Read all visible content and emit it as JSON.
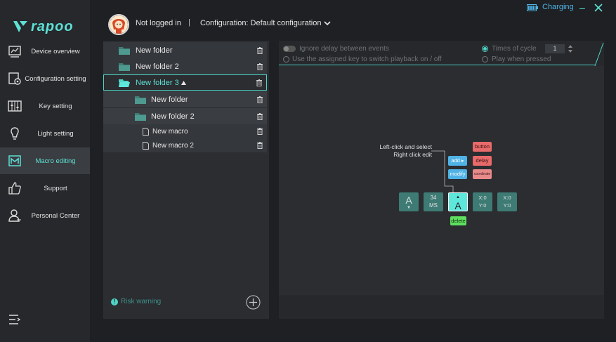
{
  "app": {
    "logo_text": "rapoo"
  },
  "header": {
    "login_status": "Not logged in",
    "separator": "|",
    "configuration": "Configuration: Default configuration",
    "charging": "Charging",
    "minimize": "–"
  },
  "sidebar": {
    "items": [
      {
        "label": "Device overview",
        "icon": "device-overview-icon"
      },
      {
        "label": "Configuration setting",
        "icon": "configuration-icon"
      },
      {
        "label": "Key setting",
        "icon": "key-setting-icon"
      },
      {
        "label": "Light setting",
        "icon": "light-bulb-icon"
      },
      {
        "label": "Macro editing",
        "icon": "macro-icon",
        "active": true
      },
      {
        "label": "Support",
        "icon": "thumbs-up-icon"
      },
      {
        "label": "Personal Center",
        "icon": "person-icon"
      }
    ]
  },
  "tree": {
    "rows": [
      {
        "label": "New folder",
        "type": "folder"
      },
      {
        "label": "New folder 2",
        "type": "folder"
      },
      {
        "label": "New folder 3",
        "type": "folder",
        "selected": true,
        "expanded": true
      },
      {
        "label": "New folder",
        "type": "subfolder"
      },
      {
        "label": "New folder 2",
        "type": "subfolder"
      },
      {
        "label": "New macro",
        "type": "macro"
      },
      {
        "label": "New macro 2",
        "type": "macro"
      }
    ],
    "risk_warning": "Risk warning",
    "risk_icon_text": "!"
  },
  "options": {
    "ignore_delay": "Ignore delay between events",
    "use_assigned_key": "Use the assigned key to switch playback on / off",
    "times_of_cycle": "Times of cycle",
    "cycle_value": "1",
    "play_when_pressed": "Play when pressed"
  },
  "editor": {
    "hint_line1": "Left-click and select",
    "hint_line2": "Right click edit",
    "buttons": {
      "button": "button",
      "add": "add",
      "delay": "delay",
      "modify": "modify",
      "coordinate": "coordinate",
      "delete": "delete"
    },
    "keys": {
      "key1_char": "A",
      "key1_sub": "▼",
      "delay_value": "34",
      "delay_unit": "MS",
      "key2_char": "A",
      "key2_sub": "▲",
      "coord1_x": "X:0",
      "coord1_y": "Y:0",
      "coord2_x": "X:0",
      "coord2_y": "Y:0"
    }
  },
  "colors": {
    "accent": "#5ee0d6",
    "danger_button": "#e86a6a",
    "add_button": "#4fb3e6",
    "delete_button": "#5fe05f"
  }
}
